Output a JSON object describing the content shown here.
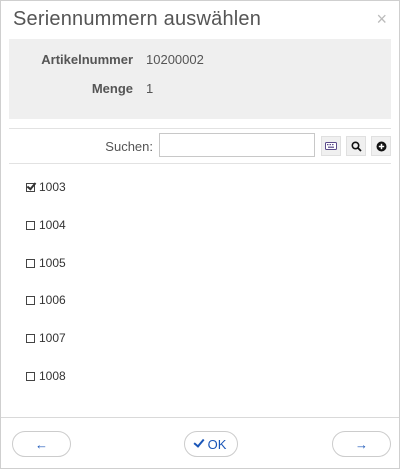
{
  "dialog": {
    "title": "Seriennummern auswählen",
    "close_label": "×"
  },
  "info": {
    "article_label": "Artikelnummer",
    "article_value": "10200002",
    "quantity_label": "Menge",
    "quantity_value": "1"
  },
  "search": {
    "label": "Suchen:",
    "value": "",
    "placeholder": ""
  },
  "toolbar_icons": [
    "keyboard-icon",
    "search-icon",
    "add-circle-icon"
  ],
  "serial_numbers": [
    {
      "number": "1003",
      "checked": true
    },
    {
      "number": "1004",
      "checked": false
    },
    {
      "number": "1005",
      "checked": false
    },
    {
      "number": "1006",
      "checked": false
    },
    {
      "number": "1007",
      "checked": false
    },
    {
      "number": "1008",
      "checked": false
    }
  ],
  "footer": {
    "back_label": "←",
    "ok_label": "OK",
    "next_label": "→"
  },
  "colors": {
    "accent": "#1a56b8",
    "info_background": "#efefef",
    "title_text": "#555555"
  }
}
